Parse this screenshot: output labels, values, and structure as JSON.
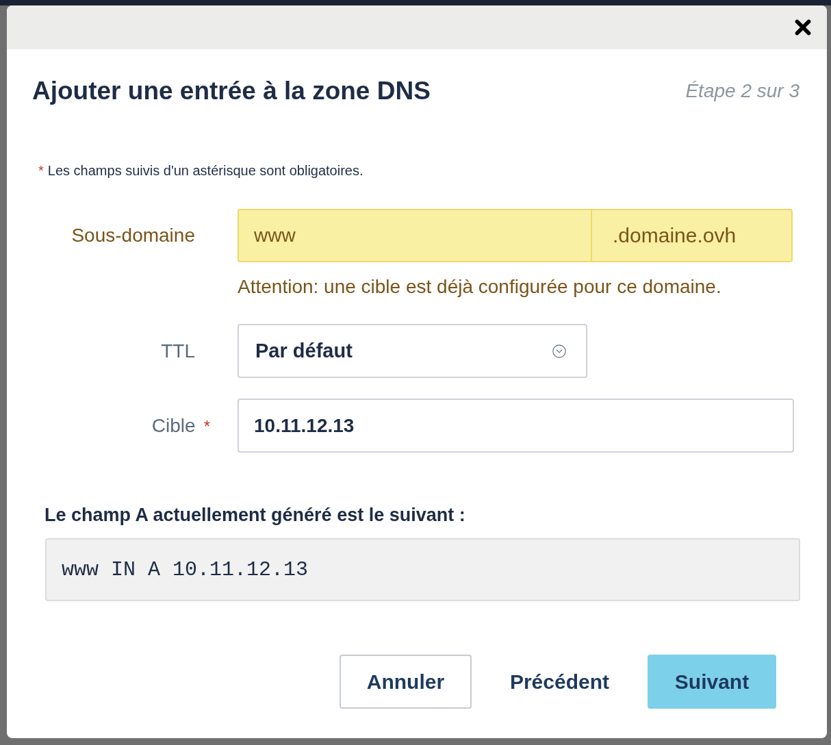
{
  "dialog": {
    "title": "Ajouter une entrée à la zone DNS",
    "step": "Étape 2 sur 3",
    "required_note": {
      "mark": "*",
      "text": "Les champs suivis d'un astérisque sont obligatoires."
    },
    "fields": [
      {
        "kind": "subdomain",
        "label": "Sous-domaine",
        "value": "www",
        "suffix": ".domaine.ovh",
        "warning": "Attention: une cible est déjà configurée pour ce domaine."
      },
      {
        "kind": "select",
        "label": "TTL",
        "value": "Par défaut"
      },
      {
        "kind": "text",
        "label": "Cible",
        "required_mark": "*",
        "value": "10.11.12.13"
      }
    ],
    "preview": {
      "heading": "Le champ A actuellement généré est le suivant :",
      "code": "www IN A 10.11.12.13"
    },
    "buttons": [
      {
        "kind": "outline",
        "label": "Annuler"
      },
      {
        "kind": "link",
        "label": "Précédent"
      },
      {
        "kind": "primary",
        "label": "Suivant"
      }
    ]
  }
}
